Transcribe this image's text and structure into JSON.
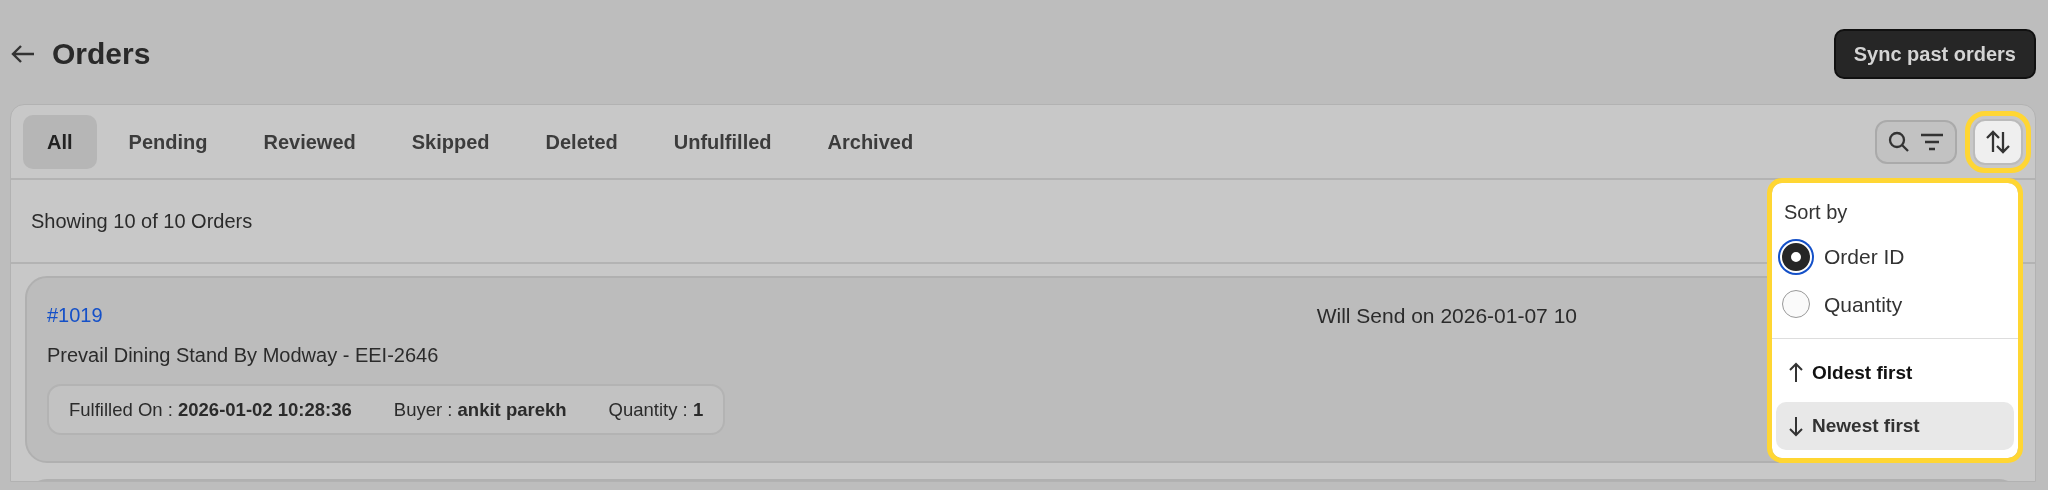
{
  "header": {
    "title": "Orders",
    "action_button": "Sync past orders"
  },
  "tabs": [
    {
      "label": "All",
      "selected": true
    },
    {
      "label": "Pending",
      "selected": false
    },
    {
      "label": "Reviewed",
      "selected": false
    },
    {
      "label": "Skipped",
      "selected": false
    },
    {
      "label": "Deleted",
      "selected": false
    },
    {
      "label": "Unfulfilled",
      "selected": false
    },
    {
      "label": "Archived",
      "selected": false
    }
  ],
  "summary": "Showing 10 of 10 Orders",
  "orders": [
    {
      "order_id": "#1019",
      "product": "Prevail Dining Stand By Modway - EEI-2646",
      "schedule": "Will Send on 2026-01-07 10",
      "details": [
        {
          "label": "Fulfilled On :",
          "value": "2026-01-02 10:28:36"
        },
        {
          "label": "Buyer :",
          "value": "ankit parekh"
        },
        {
          "label": "Quantity :",
          "value": "1"
        }
      ]
    }
  ],
  "sort_menu": {
    "expanded": true,
    "heading": "Sort by",
    "fields": [
      {
        "label": "Order ID",
        "selected": true
      },
      {
        "label": "Quantity",
        "selected": false
      }
    ],
    "directions": [
      {
        "label": "Oldest first",
        "kind": "up",
        "selected": true,
        "highlighted": false
      },
      {
        "label": "Newest first",
        "kind": "down",
        "selected": false,
        "highlighted": true
      }
    ]
  }
}
